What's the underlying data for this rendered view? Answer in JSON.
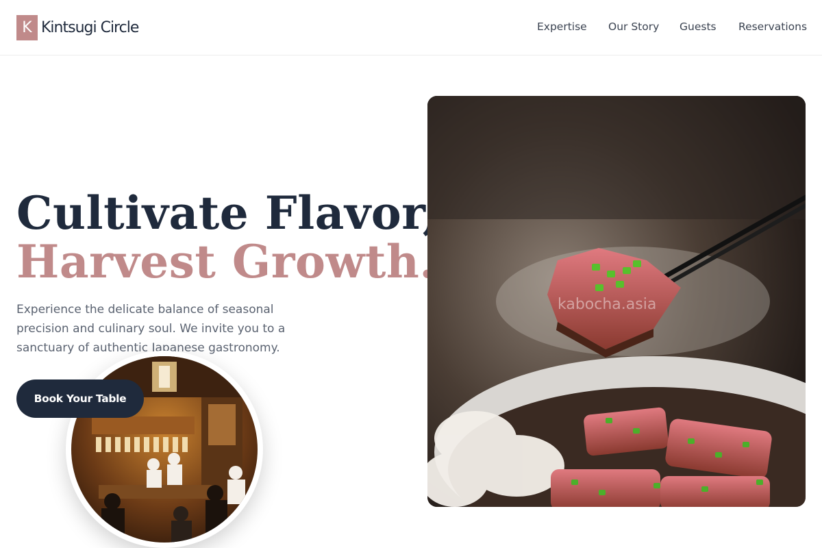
{
  "header": {
    "logo_letter": "K",
    "brand_name": "Kintsugi Circle",
    "nav": {
      "expertise": "Expertise",
      "our_story": "Our Story",
      "guests": "Guests",
      "reservations": "Reservations"
    }
  },
  "hero": {
    "headline_line1": "Cultivate Flavor,",
    "headline_line2": "Harvest Growth.",
    "subtext": "Experience the delicate balance of seasonal precision and culinary soul. We invite you to a sanctuary of authentic Japanese gastronomy.",
    "cta_label": "Book Your Table"
  },
  "media": {
    "main_photo_watermark": "kabocha.asia",
    "main_photo_subject": "seared beef tataki held by chopsticks over a bowl",
    "circle_photo_subject": "interior of a Japanese izakaya with chefs and diners"
  },
  "colors": {
    "accent_rose": "#c08a8a",
    "navy": "#1f2a3c",
    "body_text": "#5a6270",
    "nav_text": "#3a4250"
  }
}
